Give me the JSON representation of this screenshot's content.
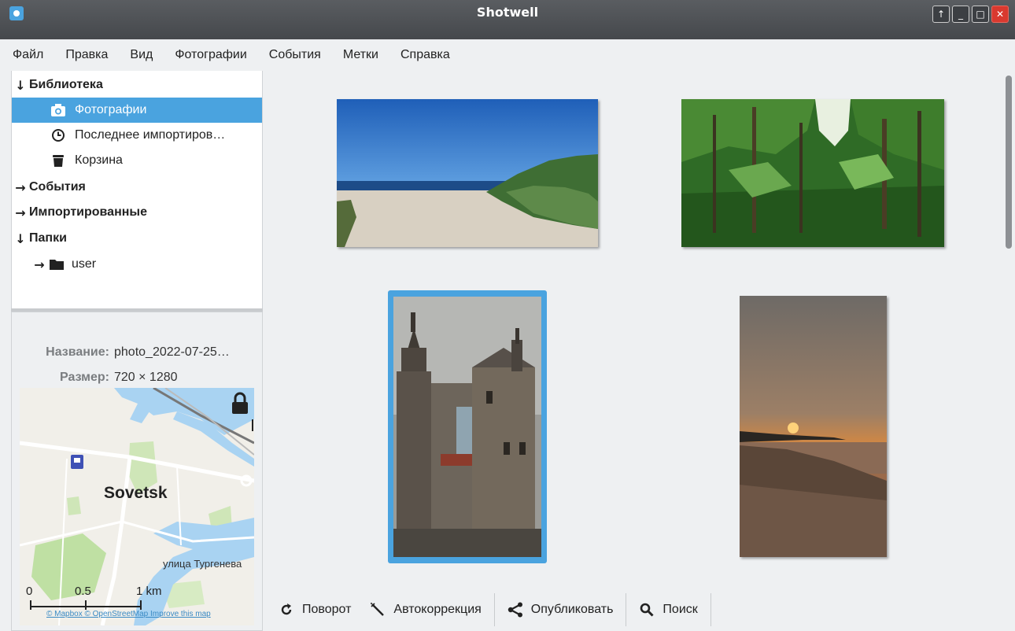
{
  "window": {
    "title": "Shotwell",
    "controls": [
      "↑",
      "_",
      "□",
      "✕"
    ]
  },
  "menu": [
    "Файл",
    "Правка",
    "Вид",
    "Фотографии",
    "События",
    "Метки",
    "Справка"
  ],
  "sidebar": {
    "library": "Библиотека",
    "photos": "Фотографии",
    "recent": "Последнее импортиров…",
    "trash": "Корзина",
    "events": "События",
    "imported": "Импортированные",
    "folders": "Папки",
    "user": "user"
  },
  "info": {
    "name_label": "Название:",
    "name_value": "photo_2022-07-25…",
    "size_label": "Размер:",
    "size_value": "720 × 1280"
  },
  "map": {
    "city": "Sovetsk",
    "street": "улица Тургенева",
    "scale": [
      "0",
      "0.5",
      "1 km"
    ],
    "attribution": "© Mapbox © OpenStreetMap Improve this map"
  },
  "toolbar": {
    "rotate": "Поворот",
    "autofix": "Автокоррекция",
    "publish": "Опубликовать",
    "search": "Поиск"
  },
  "colors": {
    "accent": "#4aa3df"
  }
}
